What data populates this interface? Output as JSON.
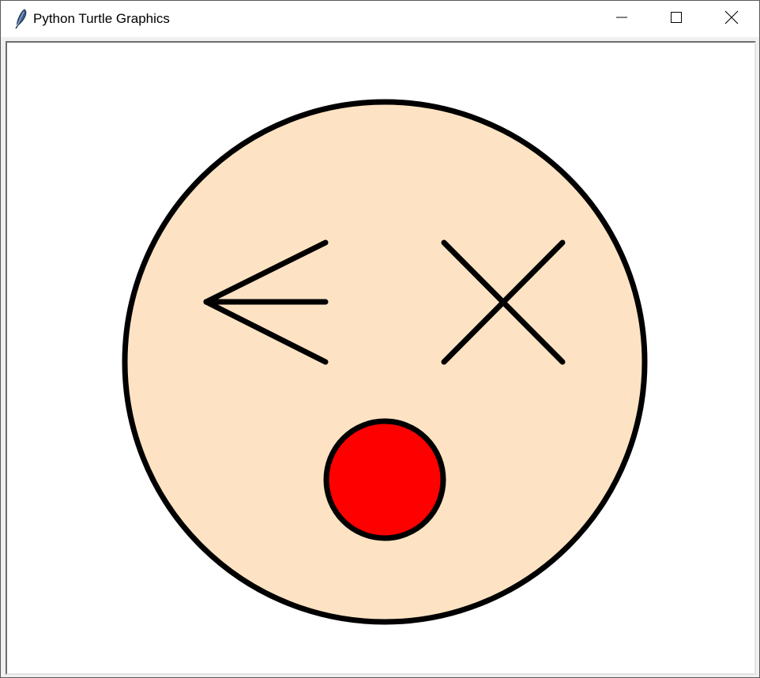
{
  "window": {
    "title": "Python Turtle Graphics",
    "controls": {
      "minimize_icon": "minimize-icon",
      "maximize_icon": "maximize-icon",
      "close_icon": "close-icon"
    }
  },
  "canvas": {
    "background": "#ffffff",
    "drawing": {
      "face_fill": "#fde3c3",
      "mouth_fill": "#ff0000",
      "stroke": "#000000"
    }
  }
}
